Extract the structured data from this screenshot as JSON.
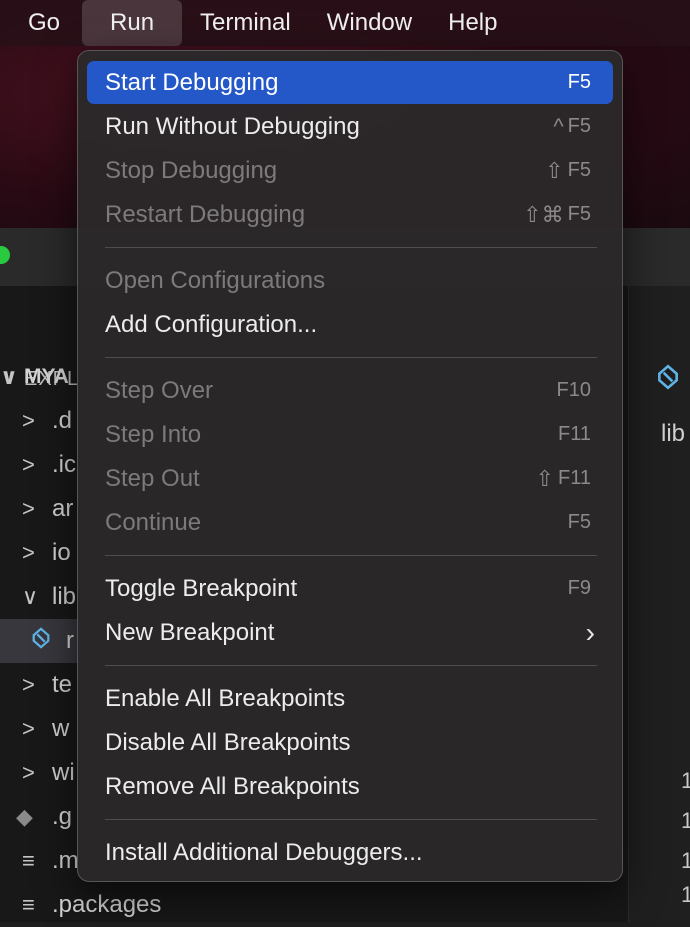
{
  "menubar": {
    "items": [
      "Go",
      "Run",
      "Terminal",
      "Window",
      "Help"
    ],
    "active": "Run"
  },
  "background": {
    "explorer_title": "EXPL",
    "tree": [
      {
        "label": "MYA",
        "chevron": "∨",
        "kind": "root"
      },
      {
        "label": ".d",
        "chevron": ">"
      },
      {
        "label": ".ic",
        "chevron": ">"
      },
      {
        "label": "ar",
        "chevron": ">"
      },
      {
        "label": "io",
        "chevron": ">"
      },
      {
        "label": "lib",
        "chevron": "∨"
      },
      {
        "label": "r",
        "chevron": "",
        "kind": "selected"
      },
      {
        "label": "te",
        "chevron": ">"
      },
      {
        "label": "w",
        "chevron": ">"
      },
      {
        "label": "wi",
        "chevron": ">"
      },
      {
        "label": ".g",
        "chevron": "◆"
      },
      {
        "label": ".m",
        "chevron": "≡"
      },
      {
        "label": ".packages",
        "chevron": "≡"
      }
    ],
    "editor_crumb": "lib",
    "line_numbers": [
      "1",
      "1",
      "1",
      "1"
    ]
  },
  "run_menu": {
    "groups": [
      [
        {
          "label": "Start Debugging",
          "shortcut": "F5",
          "mods": "",
          "enabled": true,
          "highlighted": true
        },
        {
          "label": "Run Without Debugging",
          "shortcut": "F5",
          "mods": "^",
          "enabled": true
        },
        {
          "label": "Stop Debugging",
          "shortcut": "F5",
          "mods": "⇧",
          "enabled": false
        },
        {
          "label": "Restart Debugging",
          "shortcut": "F5",
          "mods": "⇧⌘",
          "enabled": false
        }
      ],
      [
        {
          "label": "Open Configurations",
          "shortcut": "",
          "mods": "",
          "enabled": false
        },
        {
          "label": "Add Configuration...",
          "shortcut": "",
          "mods": "",
          "enabled": true
        }
      ],
      [
        {
          "label": "Step Over",
          "shortcut": "F10",
          "mods": "",
          "enabled": false
        },
        {
          "label": "Step Into",
          "shortcut": "F11",
          "mods": "",
          "enabled": false
        },
        {
          "label": "Step Out",
          "shortcut": "F11",
          "mods": "⇧",
          "enabled": false
        },
        {
          "label": "Continue",
          "shortcut": "F5",
          "mods": "",
          "enabled": false
        }
      ],
      [
        {
          "label": "Toggle Breakpoint",
          "shortcut": "F9",
          "mods": "",
          "enabled": true
        },
        {
          "label": "New Breakpoint",
          "shortcut": "",
          "mods": "",
          "enabled": true,
          "submenu": true
        }
      ],
      [
        {
          "label": "Enable All Breakpoints",
          "shortcut": "",
          "mods": "",
          "enabled": true
        },
        {
          "label": "Disable All Breakpoints",
          "shortcut": "",
          "mods": "",
          "enabled": true
        },
        {
          "label": "Remove All Breakpoints",
          "shortcut": "",
          "mods": "",
          "enabled": true
        }
      ],
      [
        {
          "label": "Install Additional Debuggers...",
          "shortcut": "",
          "mods": "",
          "enabled": true
        }
      ]
    ]
  },
  "colors": {
    "highlight": "#2458c8",
    "menu_bg": "#2b282a",
    "disabled_text": "#7d7a7c"
  }
}
